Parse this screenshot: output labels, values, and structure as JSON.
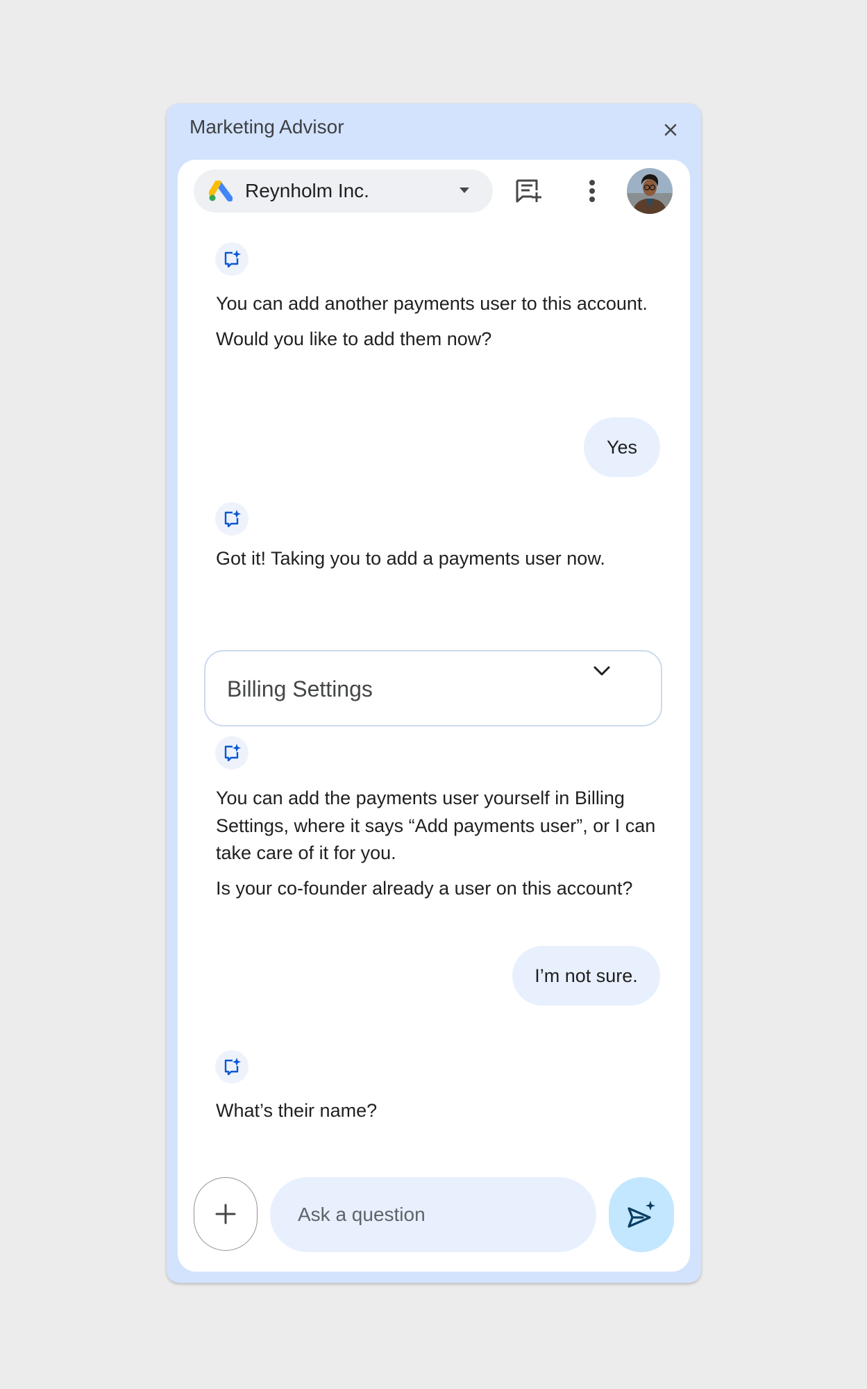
{
  "panel": {
    "title": "Marketing Advisor"
  },
  "header": {
    "account_name": "Reynholm Inc."
  },
  "messages": [
    {
      "role": "bot",
      "paragraphs": [
        "You can add another payments user to this account.",
        "Would you like to add them now?"
      ]
    },
    {
      "role": "user",
      "text": "Yes"
    },
    {
      "role": "bot",
      "paragraphs": [
        "Got it! Taking you to add a payments user now."
      ]
    },
    {
      "role": "bot",
      "paragraphs": [
        "You can add the payments user yourself in Billing Settings, where it says “Add payments user”, or I can take care of it for you.",
        "Is your co-founder already a user on this account?"
      ]
    },
    {
      "role": "user",
      "text": "I’m not sure."
    },
    {
      "role": "bot",
      "paragraphs": [
        "What’s their name?"
      ]
    }
  ],
  "billing_dropdown": {
    "label": "Billing Settings"
  },
  "composer": {
    "placeholder": "Ask a question"
  },
  "icons": {
    "close": "close-icon",
    "account_logo": "google-ads-logo",
    "dropdown": "caret-down-icon",
    "new_chat": "new-chat-icon",
    "more": "more-vert-icon",
    "avatar": "user-avatar",
    "bot": "bot-spark-icon",
    "chevron": "chevron-down-icon",
    "add": "plus-icon",
    "send": "send-spark-icon"
  },
  "colors": {
    "panel_bg": "#d3e3fd",
    "card_bg": "#ffffff",
    "user_bubble": "#e8f0fe",
    "send_button": "#c2e7ff",
    "accent_blue": "#0b57d0"
  }
}
